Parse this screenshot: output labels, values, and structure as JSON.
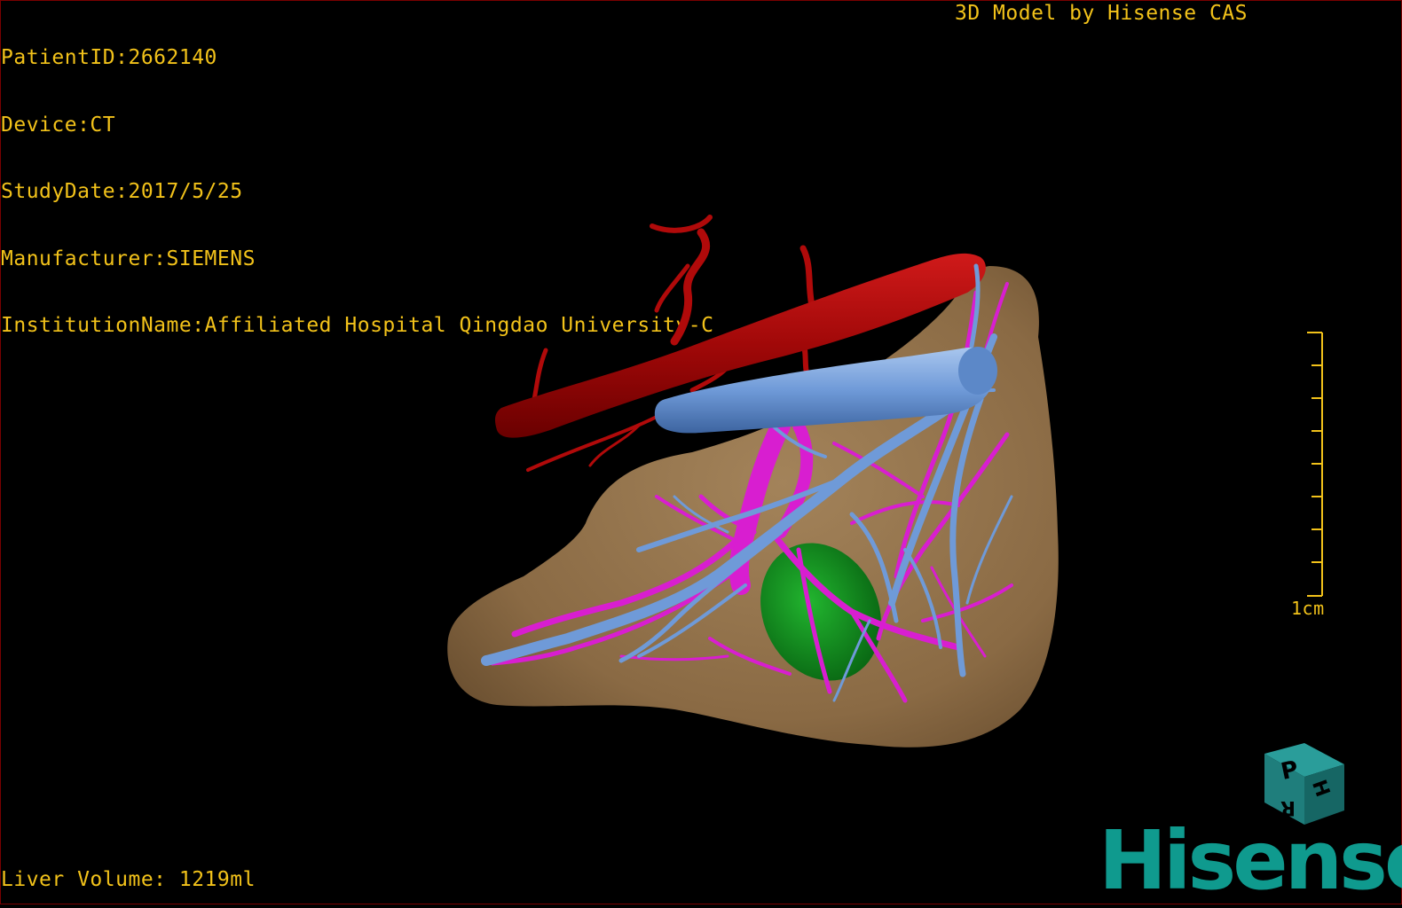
{
  "info": {
    "patient_id": "PatientID:2662140",
    "device": "Device:CT",
    "study_date": "StudyDate:2017/5/25",
    "manufacturer": "Manufacturer:SIEMENS",
    "institution": "InstitutionName:Affiliated Hospital Qingdao University-C"
  },
  "header_right": "3D Model by Hisense CAS",
  "footer": {
    "liver_volume": "Liver Volume: 1219ml"
  },
  "scale_bar": {
    "label": "1cm"
  },
  "orientation_cube": {
    "faces": [
      "P",
      "H",
      "R"
    ]
  },
  "logo": {
    "text": "Hisense"
  },
  "colors": {
    "overlay_text": "#f2c21a",
    "liver": "#8b6c47",
    "artery": "#b00a0a",
    "hepatic_vein": "#6f9ad8",
    "portal_vein": "#d81ed0",
    "lesion": "#0e8a1e",
    "logo": "#0f9a8e"
  }
}
